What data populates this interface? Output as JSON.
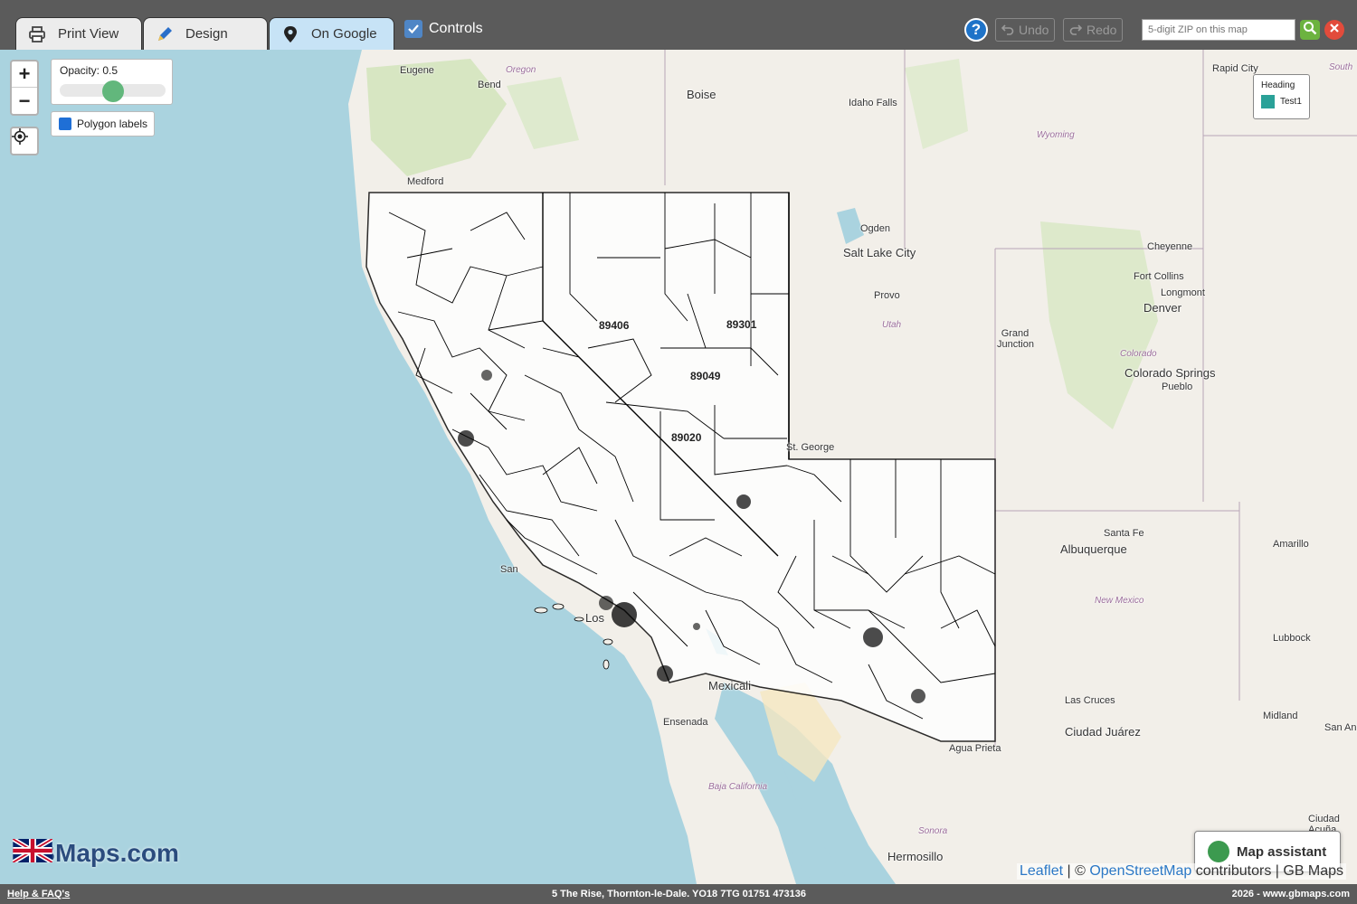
{
  "tabs": [
    {
      "label": "Print View",
      "icon": "printer-icon"
    },
    {
      "label": "Design",
      "icon": "pencil-icon"
    },
    {
      "label": "On Google",
      "icon": "map-pin-icon"
    }
  ],
  "controls_label": "Controls",
  "toolbar": {
    "help_label": "?",
    "undo_label": "Undo",
    "redo_label": "Redo",
    "zip_placeholder": "5-digit ZIP on this map"
  },
  "map_controls": {
    "zoom_in": "+",
    "zoom_out": "−",
    "opacity_label": "Opacity: 0.5",
    "opacity_value": 0.5,
    "polygon_labels": "Polygon labels"
  },
  "legend": {
    "heading": "Heading",
    "items": [
      {
        "label": "Test1",
        "color": "#2aa198"
      }
    ]
  },
  "zip_labels": [
    "89406",
    "89301",
    "89049",
    "89020"
  ],
  "places": [
    {
      "name": "Eugene",
      "cls": ""
    },
    {
      "name": "Oregon",
      "cls": "region"
    },
    {
      "name": "Bend",
      "cls": ""
    },
    {
      "name": "Boise",
      "cls": "big"
    },
    {
      "name": "Idaho Falls",
      "cls": ""
    },
    {
      "name": "Rapid City",
      "cls": ""
    },
    {
      "name": "South",
      "cls": "region"
    },
    {
      "name": "Medford",
      "cls": ""
    },
    {
      "name": "Wyoming",
      "cls": "region"
    },
    {
      "name": "Ogden",
      "cls": ""
    },
    {
      "name": "Salt Lake City",
      "cls": "big"
    },
    {
      "name": "Provo",
      "cls": ""
    },
    {
      "name": "Utah",
      "cls": "region"
    },
    {
      "name": "Cheyenne",
      "cls": ""
    },
    {
      "name": "Fort Collins",
      "cls": ""
    },
    {
      "name": "Longmont",
      "cls": ""
    },
    {
      "name": "Denver",
      "cls": "big"
    },
    {
      "name": "Grand Junction",
      "cls": ""
    },
    {
      "name": "Colorado",
      "cls": "region"
    },
    {
      "name": "Colorado Springs",
      "cls": "big"
    },
    {
      "name": "Pueblo",
      "cls": ""
    },
    {
      "name": "St. George",
      "cls": ""
    },
    {
      "name": "Santa Fe",
      "cls": ""
    },
    {
      "name": "Albuquerque",
      "cls": "big"
    },
    {
      "name": "Amarillo",
      "cls": ""
    },
    {
      "name": "New Mexico",
      "cls": "region"
    },
    {
      "name": "Lubbock",
      "cls": ""
    },
    {
      "name": "Las Cruces",
      "cls": ""
    },
    {
      "name": "Ciudad Juárez",
      "cls": "big"
    },
    {
      "name": "Midland",
      "cls": ""
    },
    {
      "name": "San Ang",
      "cls": ""
    },
    {
      "name": "Agua Prieta",
      "cls": ""
    },
    {
      "name": "Mexicali",
      "cls": "big"
    },
    {
      "name": "Ensenada",
      "cls": ""
    },
    {
      "name": "Baja California",
      "cls": "region"
    },
    {
      "name": "Sonora",
      "cls": "region"
    },
    {
      "name": "Hermosillo",
      "cls": "big"
    },
    {
      "name": "Ciudad Acuña",
      "cls": ""
    },
    {
      "name": "Los",
      "cls": "big"
    },
    {
      "name": "San",
      "cls": ""
    }
  ],
  "logo_text": "GBMaps.com",
  "assistant_label": "Map assistant",
  "attribution": {
    "leaflet": "Leaflet",
    "sep": " | © ",
    "osm": "OpenStreetMap",
    "rest": " contributors | GB Maps"
  },
  "footer": {
    "left": "Help & FAQ's",
    "mid": "5 The Rise, Thornton-le-Dale. YO18 7TG    01751 473136",
    "right": "2026 - www.gbmaps.com"
  }
}
